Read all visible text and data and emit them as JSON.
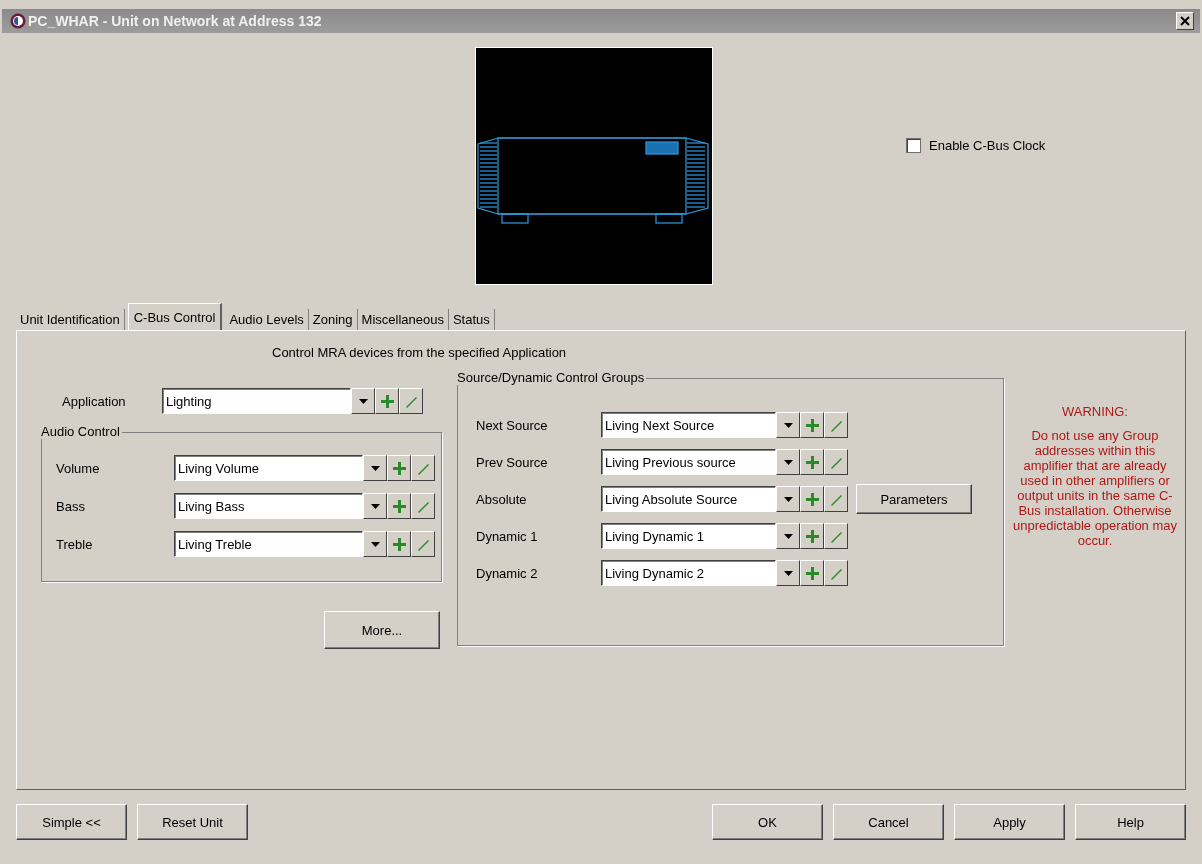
{
  "window": {
    "title": "PC_WHAR - Unit on Network at Address 132"
  },
  "enable_clock": {
    "label": "Enable C-Bus Clock",
    "checked": false
  },
  "tabs": [
    {
      "label": "Unit Identification",
      "selected": false
    },
    {
      "label": "C-Bus Control",
      "selected": true
    },
    {
      "label": "Audio Levels",
      "selected": false
    },
    {
      "label": "Zoning",
      "selected": false
    },
    {
      "label": "Miscellaneous",
      "selected": false
    },
    {
      "label": "Status",
      "selected": false
    }
  ],
  "panel": {
    "heading": "Control MRA devices from the specified Application",
    "application": {
      "label": "Application",
      "value": "Lighting"
    },
    "audio_control": {
      "title": "Audio Control",
      "rows": [
        {
          "label": "Volume",
          "value": "Living Volume"
        },
        {
          "label": "Bass",
          "value": "Living Bass"
        },
        {
          "label": "Treble",
          "value": "Living Treble"
        }
      ]
    },
    "more_button": "More...",
    "source_group": {
      "title": "Source/Dynamic Control Groups",
      "rows": [
        {
          "label": "Next Source",
          "value": "Living Next Source"
        },
        {
          "label": "Prev Source",
          "value": "Living Previous source"
        },
        {
          "label": "Absolute",
          "value": "Living Absolute Source",
          "button": "Parameters"
        },
        {
          "label": "Dynamic 1",
          "value": "Living Dynamic 1"
        },
        {
          "label": "Dynamic 2",
          "value": "Living Dynamic 2"
        }
      ]
    },
    "warning": {
      "title": "WARNING:",
      "text": "Do not use any Group addresses within this amplifier that are already used in other amplifiers or output units in the same C-Bus installation. Otherwise unpredictable operation may occur."
    }
  },
  "buttons_left": [
    "Simple <<",
    "Reset Unit"
  ],
  "buttons_right": [
    "OK",
    "Cancel",
    "Apply",
    "Help"
  ]
}
